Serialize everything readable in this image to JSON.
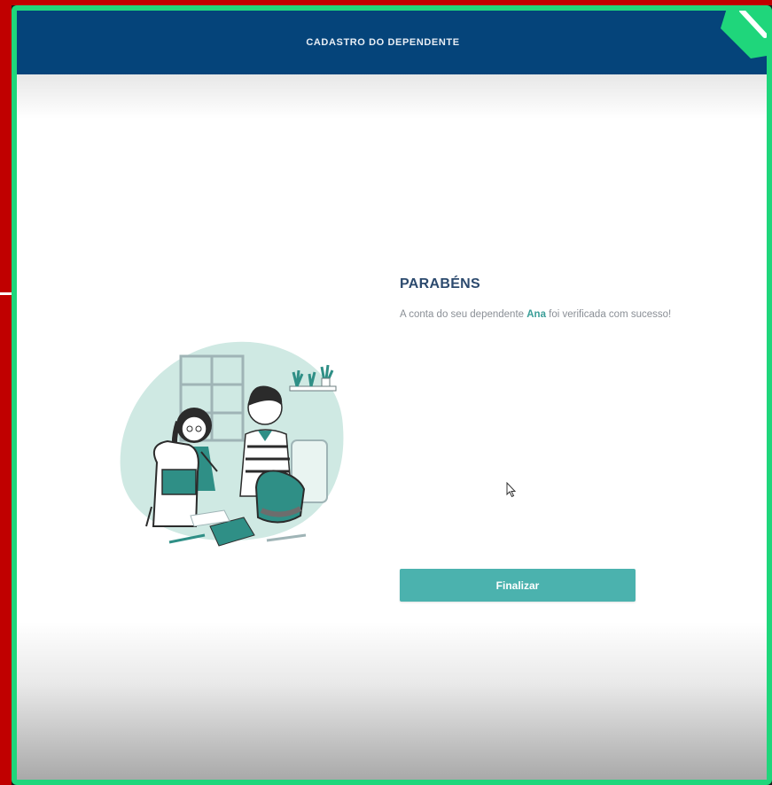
{
  "header": {
    "title": "CADASTRO DO DEPENDENTE"
  },
  "success": {
    "title": "PARABÉNS",
    "message_before": "A conta do seu dependente ",
    "dependent_name": "Ana",
    "message_after": " foi verificada com sucesso!"
  },
  "actions": {
    "finalize_label": "Finalizar"
  },
  "colors": {
    "header_bg": "#05447a",
    "accent": "#4bb2ae",
    "title": "#2c4a6e",
    "frame_border": "#1fd67b",
    "left_strip": "#c00000"
  },
  "icons": {
    "illustration": "kids-packing-backpacks-illustration",
    "cursor": "mouse-pointer-icon",
    "corner_badge": "green-corner-badge-icon"
  }
}
